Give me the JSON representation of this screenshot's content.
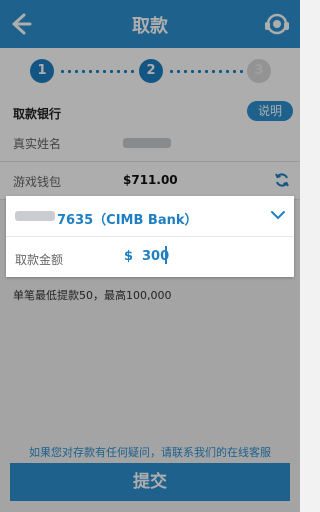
{
  "header": {
    "title": "取款",
    "back_icon": "arrow-left-icon",
    "support_icon": "headset-icon"
  },
  "steps": [
    "1",
    "2",
    "3"
  ],
  "bank_section": {
    "label": "取款银行",
    "help_label": "说明"
  },
  "fields": {
    "real_name_label": "真实姓名",
    "wallet_label": "游戏钱包",
    "wallet_balance": "$711.00"
  },
  "card": {
    "bank_suffix": "7635（CIMB Bank）",
    "amount_label": "取款金额",
    "amount_currency": "$",
    "amount_value": "300"
  },
  "limits_text": "单笔最低提款50，最高100,000",
  "contact_text": "如果您对存款有任何疑问，请联系我们的在线客服",
  "submit_label": "提交",
  "colors": {
    "primary": "#2b8fce",
    "accent": "#1e7fc2"
  }
}
